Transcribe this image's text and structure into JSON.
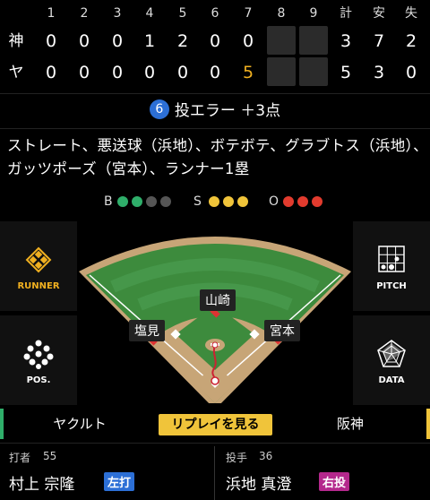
{
  "scoreboard": {
    "innings": [
      "1",
      "2",
      "3",
      "4",
      "5",
      "6",
      "7",
      "8",
      "9"
    ],
    "totals_headers": [
      "計",
      "安",
      "失"
    ],
    "teams": [
      {
        "name": "神",
        "scores": [
          "0",
          "0",
          "0",
          "1",
          "2",
          "0",
          "0",
          "",
          ""
        ],
        "totals": [
          "3",
          "7",
          "2"
        ]
      },
      {
        "name": "ヤ",
        "scores": [
          "0",
          "0",
          "0",
          "0",
          "0",
          "0",
          "5",
          "",
          ""
        ],
        "totals": [
          "5",
          "3",
          "0"
        ]
      }
    ]
  },
  "event": {
    "number": "6",
    "text": "投エラー ＋3点",
    "description": "ストレート、悪送球（浜地）、ボテボテ、グラブトス（浜地）、ガッツポーズ（宮本）、ランナー1塁"
  },
  "count": {
    "b_label": "B",
    "s_label": "S",
    "o_label": "O",
    "balls": 2,
    "strikes": 3,
    "outs": 3,
    "ball_color": "#2fae6a",
    "strike_color": "#f0c43a",
    "out_color": "#e23b2e"
  },
  "buttons": {
    "runner": "RUNNER",
    "pos": "POS.",
    "pitch": "PITCH",
    "data": "DATA"
  },
  "field_players": {
    "center": "山崎",
    "left": "塩見",
    "right": "宮本"
  },
  "tabs": {
    "left": "ヤクルト",
    "replay": "リプレイを見る",
    "right": "阪神"
  },
  "batter": {
    "role": "打者",
    "number": "55",
    "name": "村上 宗隆",
    "badge": "左打",
    "badge_color": "#2c6fd6"
  },
  "pitcher": {
    "role": "投手",
    "number": "36",
    "name": "浜地 真澄",
    "badge": "右投",
    "badge_color": "#b4288c"
  }
}
